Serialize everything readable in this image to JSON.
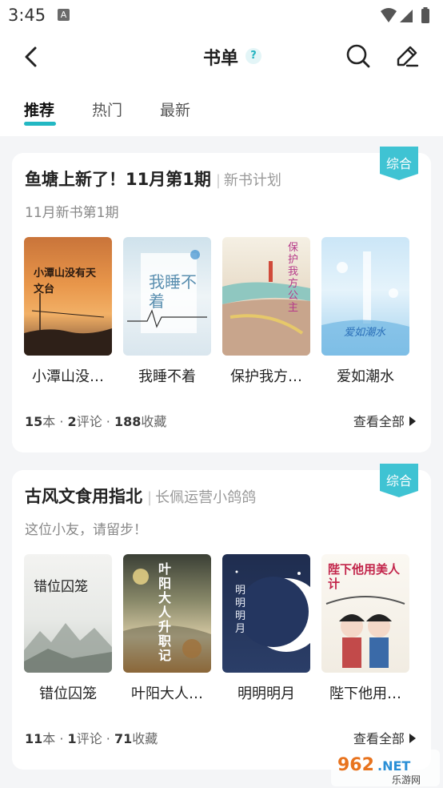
{
  "status": {
    "time": "3:45",
    "indicator": "A"
  },
  "nav": {
    "title": "书单",
    "help": "?"
  },
  "tabs": [
    {
      "label": "推荐"
    },
    {
      "label": "热门"
    },
    {
      "label": "最新"
    }
  ],
  "cards": [
    {
      "title": "鱼塘上新了！11月第1期",
      "author": "新书计划",
      "subtitle": "11月新书第1期",
      "badge": "综合",
      "books": [
        {
          "name": "小潭山没…",
          "cover_text": "小潭山没有天文台"
        },
        {
          "name": "我睡不着",
          "cover_text": "我睡不着"
        },
        {
          "name": "保护我方…",
          "cover_text": "保护我方公主"
        },
        {
          "name": "爱如潮水",
          "cover_text": "爱如潮水"
        }
      ],
      "stats": {
        "books": "15",
        "books_unit": "本",
        "comments": "2",
        "comments_unit": "评论",
        "favorites": "188",
        "favorites_unit": "收藏"
      },
      "view_all": "查看全部"
    },
    {
      "title": "古风文食用指北",
      "author": "长佩运营小鸽鸽",
      "subtitle": "这位小友，请留步！",
      "badge": "综合",
      "books": [
        {
          "name": "错位囚笼",
          "cover_text": "错位囚笼"
        },
        {
          "name": "叶阳大人…",
          "cover_text": "叶阳大人升职记"
        },
        {
          "name": "明明明月",
          "cover_text": "明明明月"
        },
        {
          "name": "陛下他用…",
          "cover_text": "陛下他用美人计"
        }
      ],
      "stats": {
        "books": "11",
        "books_unit": "本",
        "comments": "1",
        "comments_unit": "评论",
        "favorites": "71",
        "favorites_unit": "收藏"
      },
      "view_all": "查看全部"
    }
  ],
  "watermark": {
    "brand": "962.NET",
    "label": "乐游网"
  },
  "colors": {
    "accent": "#23b8c3",
    "badge": "#3fc3d3"
  }
}
